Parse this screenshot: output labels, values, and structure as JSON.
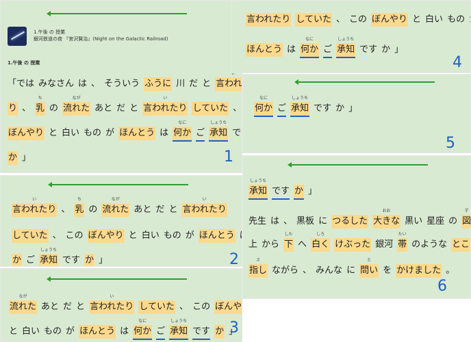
{
  "header": {
    "chapter_line": "1.午後 の 授業",
    "book_line": "銀河鉄道の夜 『宮沢賢治』(Night on the Galactic Railroad)",
    "section_title": "1.午後 の 授業"
  },
  "p1": {
    "line1": [
      "「では",
      "みなさん",
      "は",
      "、",
      "そういう",
      "ふうに",
      "川",
      "だ",
      "と",
      "言われた"
    ],
    "line1_ruby_iwa": "い",
    "line2": [
      "り",
      "、",
      "乳",
      "の",
      "流れた",
      "あと",
      "だ",
      "と",
      "言われたり",
      "していた",
      "、",
      "この"
    ],
    "ruby_chi": "ち",
    "ruby_naga": "なが",
    "ruby_i": "い",
    "line3": [
      "ぼんやり",
      "と",
      "白い",
      "もの",
      "が",
      "ほんとう",
      "は",
      "何か",
      "ご",
      "承知",
      "です"
    ],
    "ruby_nani": "なに",
    "ruby_shouchi": "しょうち",
    "line4": [
      "か",
      "」"
    ],
    "number": "1"
  },
  "p2": {
    "line1": [
      "言われたり",
      "、",
      "乳",
      "の",
      "流れた",
      "あと",
      "だ",
      "と",
      "言われたり"
    ],
    "line2": [
      "していた",
      "、",
      "この",
      "ぼんやり",
      "と",
      "白い",
      "もの",
      "が",
      "ほんとう",
      "は",
      "何"
    ],
    "line3": [
      "か",
      "ご",
      "承知",
      "です",
      "か",
      "」"
    ],
    "number": "2"
  },
  "p3": {
    "line1": [
      "流れた",
      "あと",
      "だ",
      "と",
      "言われたり",
      "していた",
      "、",
      "この",
      "ぼんやり"
    ],
    "line2": [
      "と",
      "白い",
      "もの",
      "が",
      "ほんとう",
      "は",
      "何か",
      "ご",
      "承知",
      "です",
      "か",
      "」"
    ],
    "number": "3"
  },
  "p4": {
    "line1": [
      "言われたり",
      "していた",
      "、",
      "この",
      "ぼんやり",
      "と",
      "白い",
      "もの",
      "が"
    ],
    "line2": [
      "ほんとう",
      "は",
      "何か",
      "ご",
      "承知",
      "です",
      "か",
      "」"
    ],
    "number": "4"
  },
  "p5": {
    "line1": [
      "何か",
      "ご",
      "承知",
      "です",
      "か",
      "」"
    ],
    "number": "5"
  },
  "p6": {
    "line1": [
      "承知",
      "です",
      "か",
      "」"
    ],
    "line2": [
      "先生",
      "は",
      "、",
      "黒板",
      "に",
      "つるした",
      "大きな",
      "黒い",
      "星座",
      "の",
      "図",
      "の",
      "、"
    ],
    "ruby_oo": "おお",
    "ruby_zu": "ず",
    "line3": [
      "上",
      "から",
      "下",
      "へ",
      "白く",
      "けぶった",
      "銀河",
      "帯",
      "のような",
      "ところ",
      "を"
    ],
    "ruby_shita": "した",
    "ruby_shiro": "しろ",
    "ruby_tai": "たい",
    "line4": [
      "指し",
      "ながら",
      "、",
      "みんな",
      "に",
      "問い",
      "を",
      "かけました",
      "。"
    ],
    "ruby_sa": "さ",
    "ruby_to": "と",
    "number": "6"
  },
  "colors": {
    "panel": "#d9ead3",
    "highlight": "#fbd98d",
    "pen": "#1f5fbf",
    "arrow": "#2e9e2e"
  }
}
